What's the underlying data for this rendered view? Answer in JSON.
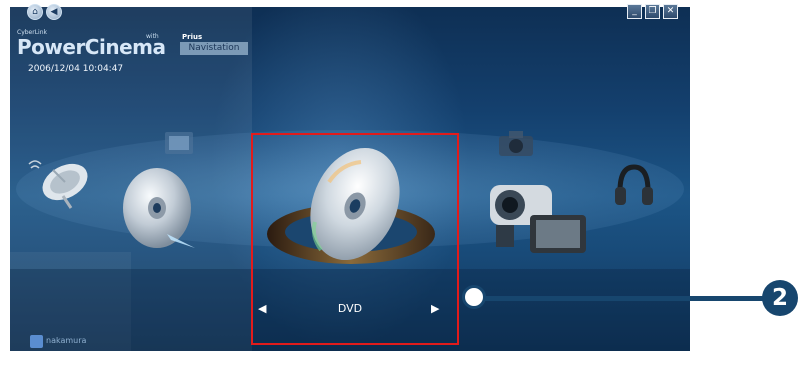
{
  "app": {
    "brand_small": "CyberLink",
    "brand": "PowerCinema",
    "brand_with": "with",
    "brand_prius": "Prius",
    "brand_sub": "Navistation",
    "datetime": "2006/12/04  10:04:47",
    "user": "nakamura"
  },
  "nav": {
    "home_icon": "⌂",
    "back_icon": "◀"
  },
  "window": {
    "minimize": "_",
    "restore": "❐",
    "close": "✕"
  },
  "carousel": {
    "selected_label": "DVD",
    "prev_arrow": "◀",
    "next_arrow": "▶",
    "items": [
      "satellite-tv-icon",
      "music-cd-icon",
      "tv-icon",
      "dvd-icon",
      "camera-icon",
      "camcorder-icon",
      "headphones-icon"
    ]
  },
  "callout": {
    "number": "2"
  },
  "colors": {
    "highlight": "#e21b1b",
    "callout": "#17466e"
  }
}
